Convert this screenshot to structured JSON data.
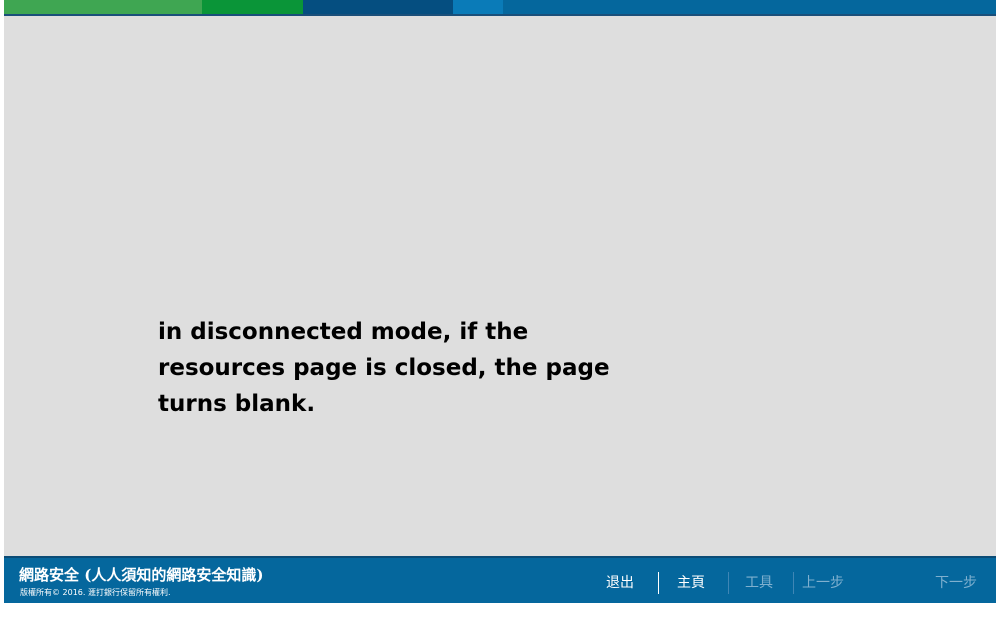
{
  "header": {
    "colors": [
      "#3fa652",
      "#0a9538",
      "#054e80",
      "#0a7bb8",
      "#05679d"
    ]
  },
  "main": {
    "message": "in disconnected mode, if the\nresources page is closed, the page\nturns blank."
  },
  "footer": {
    "title": "網路安全 (人人須知的網路安全知識)",
    "copyright": "版權所有© 2016. 滙打銀行保留所有權利.",
    "nav": {
      "exit": "退出",
      "home": "主頁",
      "tools": "工具",
      "previous": "上一步",
      "next": "下一步"
    },
    "colors": {
      "background": "#05679d",
      "active_text": "#ffffff",
      "disabled_text": "#7fb0cf"
    }
  }
}
